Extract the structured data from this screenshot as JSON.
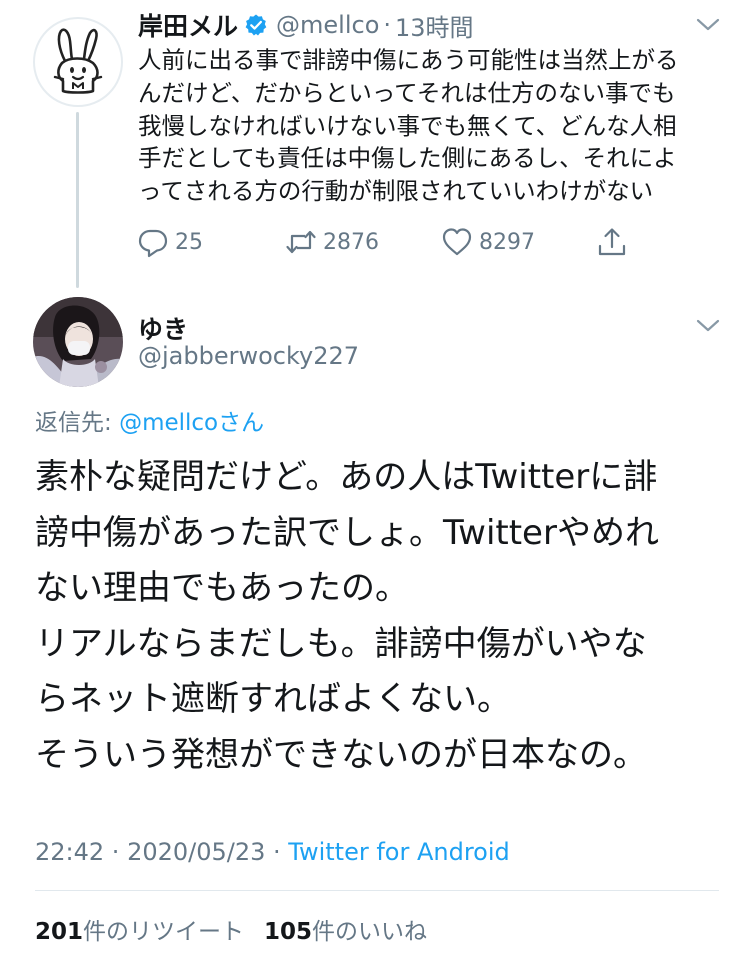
{
  "parent_tweet": {
    "author_name": "岸田メル",
    "verified": true,
    "handle": "@mellco",
    "separator": "·",
    "time": "13時間",
    "text_lines": [
      "人前に出る事で誹謗中傷にあう可能性は当然上がる",
      "んだけど、だからといってそれは仕方のない事でも",
      "我慢しなければいけない事でも無くて、どんな人相",
      "手だとしても責任は中傷した側にあるし、それによ",
      "ってされる方の行動が制限されていいわけがない"
    ],
    "replies": "25",
    "retweets": "2876",
    "likes": "8297"
  },
  "main_tweet": {
    "author_name": "ゆき",
    "handle": "@jabberwocky227",
    "replying_prefix": "返信先: ",
    "replying_mention": "@mellco",
    "replying_suffix": "さん",
    "text_lines": [
      "素朴な疑問だけど。あの人はTwitterに誹",
      "謗中傷があった訳でしょ。Twitterやめれ",
      "ない理由でもあったの。",
      "リアルならまだしも。誹謗中傷がいやな",
      "らネット遮断すればよくない。",
      "そういう発想ができないのが日本なの。"
    ],
    "time": "22:42",
    "date": "2020/05/23",
    "meta_separator": " · ",
    "source": "Twitter for Android",
    "retweet_count": "201",
    "retweet_label": "件のリツイート",
    "like_count": "105",
    "like_label": "件のいいね"
  },
  "colors": {
    "text": "#14171a",
    "secondary": "#657786",
    "accent": "#1da1f2",
    "thread_line": "#cfd9de"
  },
  "icons": [
    "rabbit-avatar-icon",
    "verified-badge-icon",
    "chevron-down-icon",
    "reply-icon",
    "retweet-icon",
    "like-icon",
    "share-icon"
  ]
}
